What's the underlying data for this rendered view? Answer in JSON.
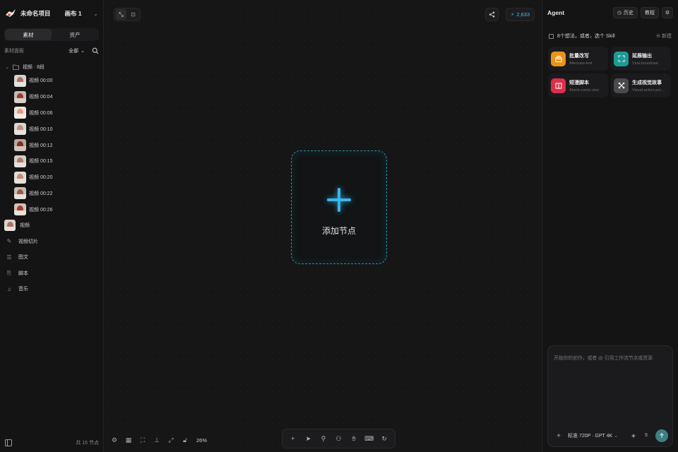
{
  "header": {
    "project_name": "未命名项目",
    "canvas_name": "画布 1"
  },
  "left_panel": {
    "tabs": [
      {
        "label": "素材",
        "active": true
      },
      {
        "label": "资产",
        "active": false
      }
    ],
    "panel_title": "素材面板",
    "filter_label": "全部",
    "folder": {
      "name": "视频 · 8段"
    },
    "videos": [
      {
        "label": "视频 00:00"
      },
      {
        "label": "视频 00:04"
      },
      {
        "label": "视频 00:06"
      },
      {
        "label": "视频 00:10"
      },
      {
        "label": "视频 00:12"
      },
      {
        "label": "视频 00:15"
      },
      {
        "label": "视频 00:20"
      },
      {
        "label": "视频 00:22"
      },
      {
        "label": "视频 00:26"
      }
    ],
    "categories": [
      {
        "label": "视频",
        "icon": "video-thumbnail"
      },
      {
        "label": "视频切片",
        "icon": "edit-icon"
      },
      {
        "label": "图文",
        "icon": "text-align-icon"
      },
      {
        "label": "脚本",
        "icon": "script-icon"
      },
      {
        "label": "音乐",
        "icon": "music-icon"
      }
    ],
    "footer": {
      "count_label": "共 15 节点"
    }
  },
  "canvas": {
    "credits": "2,633",
    "add_node_label": "添加节点",
    "zoom": "26%",
    "accent": "#3fb6e8"
  },
  "right_panel": {
    "title": "Agent",
    "history_label": "历史",
    "tutorial_label": "教程",
    "hint": "8个想法，或者，选个 Skill",
    "new_label": "新建",
    "skills": [
      {
        "name": "批量改写",
        "sub": "Alternate-text",
        "color": "#e8941a",
        "icon": "box-icon"
      },
      {
        "name": "延展输出",
        "sub": "Viral-broadcast",
        "color": "#1f9a95",
        "icon": "expand-icon"
      },
      {
        "name": "短漫脚本",
        "sub": "Abent-comic-stve",
        "color": "#d9304a",
        "icon": "book-icon"
      },
      {
        "name": "生成视觉故事",
        "sub": "Visual-action-pro...",
        "color": "#4a4a4d",
        "icon": "scatter-icon"
      }
    ],
    "input": {
      "placeholder": "开始你的创作，或者 @ 引用工作流节点或资源",
      "model_label": "标准 720P · GPT 4K"
    }
  }
}
